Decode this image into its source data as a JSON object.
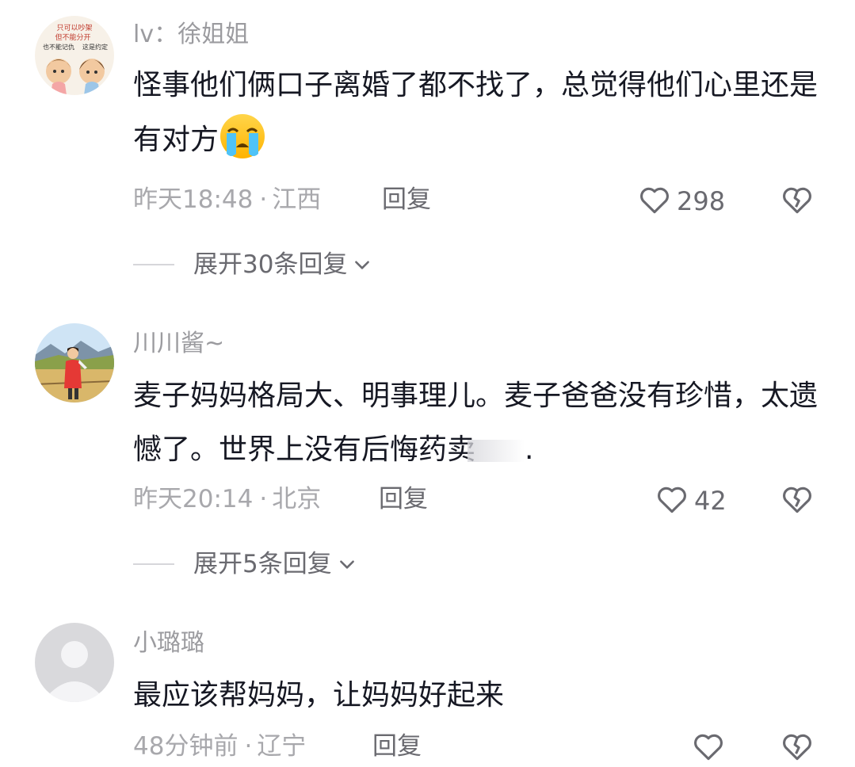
{
  "comments": [
    {
      "username": "lv：徐姐姐",
      "text": "怪事他们俩口子离婚了都不找了，总觉得他们心里还是有对方",
      "emoji": "loudly-crying-face-emoji",
      "time": "昨天18:48",
      "separator": "·",
      "location": "江西",
      "reply_label": "回复",
      "likes": "298",
      "expand_label": "展开30条回复",
      "avatar_text": [
        "只可以吵架",
        "但不能分开",
        "也不能记仇",
        "这是约定"
      ]
    },
    {
      "username": "川川酱~",
      "text": "麦子妈妈格局大、明事理儿。麦子爸爸没有珍惜，太遗憾了。世界上没有后悔药卖",
      "trailing": ".",
      "time": "昨天20:14",
      "separator": "·",
      "location": "北京",
      "reply_label": "回复",
      "likes": "42",
      "expand_label": "展开5条回复"
    },
    {
      "username": "小璐璐",
      "text": "最应该帮妈妈，让妈妈好起来",
      "time": "48分钟前",
      "separator": "·",
      "location": "辽宁",
      "reply_label": "回复",
      "likes": ""
    }
  ],
  "icons": {
    "like": "heart-outline-icon",
    "dislike": "broken-heart-icon",
    "expand": "chevron-down-icon"
  },
  "colors": {
    "text": "#161823",
    "secondary": "#9b9b9f",
    "icon": "#6a6a70"
  }
}
